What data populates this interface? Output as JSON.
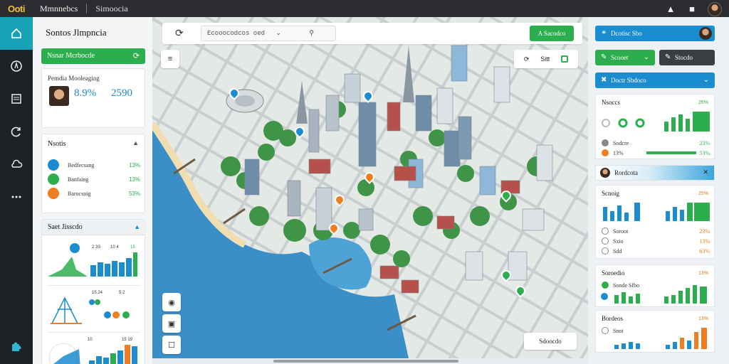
{
  "app": {
    "logo": "Ooti",
    "title": "Mmnnebcs",
    "module": "Simoocia"
  },
  "topbar": {
    "icons": [
      "bell-icon",
      "camera-icon",
      "user-avatar"
    ]
  },
  "rail": {
    "items": [
      "home-icon",
      "compass-icon",
      "list-icon",
      "refresh-icon",
      "cloud-icon",
      "more-icon"
    ],
    "bottom": "puzzle-icon"
  },
  "left": {
    "title": "Sontos Jlmpncia",
    "green_button": "Nsnar Mcrbocde",
    "profile": {
      "label": "Pemdia Mooleaging",
      "kpi_a": "8.9%",
      "kpi_b": "2590"
    },
    "notices": {
      "title": "Nsotis",
      "rows": [
        {
          "label": "Bedfecsang",
          "value": "13%",
          "color": "#1a8ccf"
        },
        {
          "label": "Banfaing",
          "value": "13%",
          "color": "#2dae4e"
        },
        {
          "label": "Barocsnig",
          "value": "53%",
          "color": "#f07e1e"
        }
      ]
    },
    "stats": {
      "title": "Saet Jisscdo",
      "chart1": {
        "labels": [
          "2 3S",
          "10 4",
          "15"
        ],
        "values": [
          3,
          4,
          4,
          5,
          4,
          5,
          6
        ]
      },
      "chart2": {
        "labels": [
          "15 24",
          "5 2"
        ],
        "values": []
      },
      "chart3": {
        "labels": [
          "10",
          "15 19"
        ],
        "values": [
          2,
          3,
          3,
          4,
          3,
          4,
          5,
          6,
          5
        ]
      }
    }
  },
  "map": {
    "search_placeholder": "Ecooocodcos oed",
    "action": "A Sacodco",
    "layer_label": "Sitt",
    "badge": "Sdoocdo"
  },
  "right": {
    "btn_top": "Dcotisc Sbo",
    "btn_green": "Scooet",
    "btn_dark": "Stocdo",
    "btn_blue": "Doctr Sbdoco",
    "card1": {
      "title": "Nsoccs",
      "tag": "26%",
      "rows": [
        {
          "label": "Sodcre",
          "value": "23%"
        },
        {
          "label": "13%",
          "value": "53%"
        }
      ]
    },
    "user_strip": "Rordcota",
    "card2": {
      "title": "Scnoig",
      "tag": "25%",
      "rows": [
        {
          "label": "Soroot",
          "value": "23%"
        },
        {
          "label": "Sxio",
          "value": "13%"
        },
        {
          "label": "Sdd",
          "value": "63%"
        }
      ]
    },
    "card3": {
      "title": "Soroedio",
      "tag": "13%",
      "row": "Sonde Sfbo"
    },
    "card4": {
      "title": "Bordeos",
      "tag": "13%",
      "row": "Snot"
    }
  }
}
